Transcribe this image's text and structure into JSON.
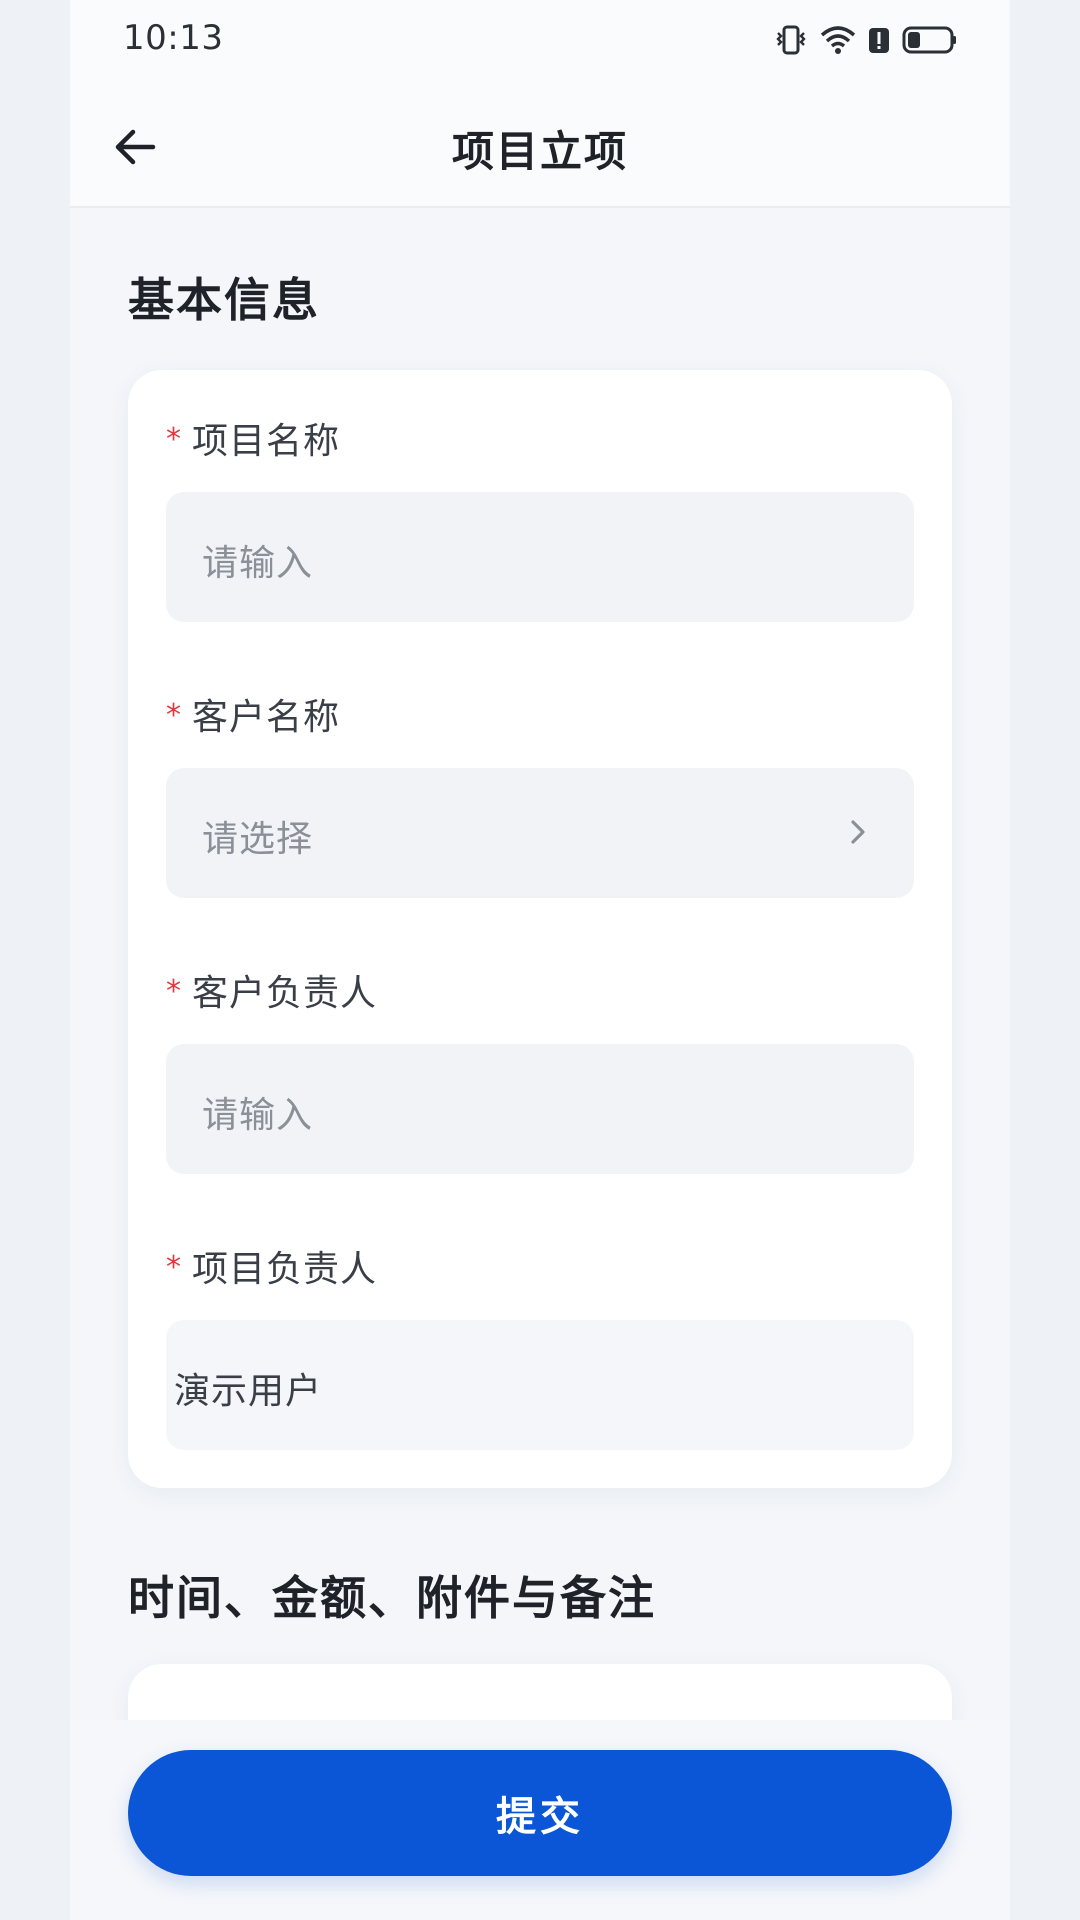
{
  "status_bar": {
    "time": "10:13",
    "icons": [
      "vibrate-icon",
      "wifi-icon",
      "battery-alert-icon",
      "battery-icon"
    ]
  },
  "header": {
    "title": "项目立项",
    "back_icon": "arrow-left-icon"
  },
  "sections": {
    "basic_info": {
      "title": "基本信息",
      "fields": [
        {
          "label": "项目名称",
          "required": "*",
          "placeholder": "请输入",
          "type": "input"
        },
        {
          "label": "客户名称",
          "required": "*",
          "placeholder": "请选择",
          "type": "select"
        },
        {
          "label": "客户负责人",
          "required": "*",
          "placeholder": "请输入",
          "type": "input"
        },
        {
          "label": "项目负责人",
          "required": "*",
          "value": "演示用户",
          "type": "readonly"
        }
      ]
    },
    "time_amount": {
      "title": "时间、金额、附件与备注"
    }
  },
  "submit": {
    "label": "提交"
  },
  "colors": {
    "primary": "#0a56d6",
    "required": "#e0383e",
    "background": "#f4f6fa",
    "card": "#ffffff",
    "input_bg": "#f1f3f6"
  }
}
